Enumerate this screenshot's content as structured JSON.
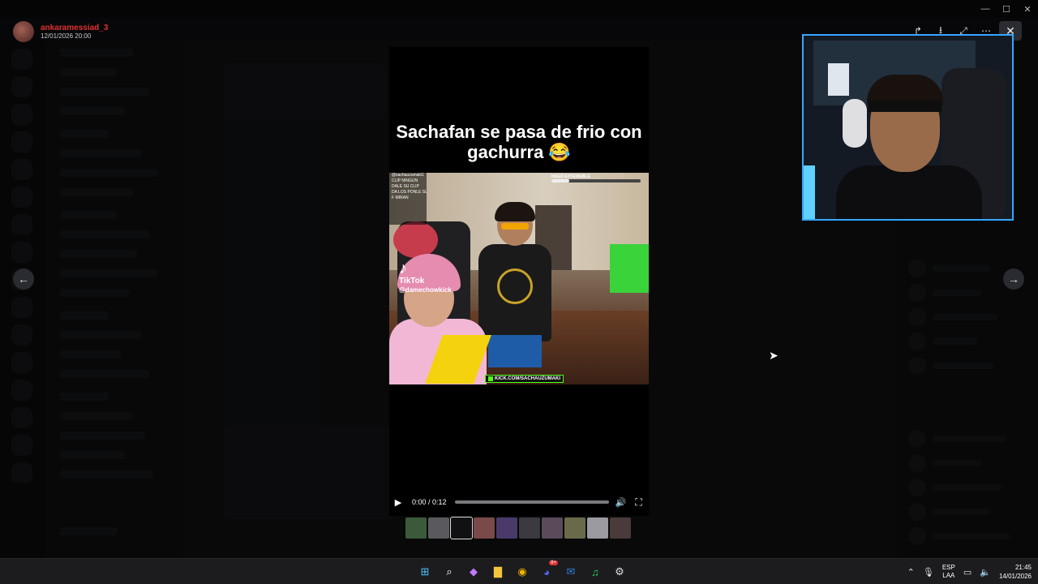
{
  "uploader": {
    "name": "ankaramessiad_3",
    "date": "12/01/2026 20:00"
  },
  "window": {
    "title": "",
    "minimize": "—",
    "maximize": "☐",
    "close": "✕"
  },
  "viewer_toolbar": {
    "share": "↱",
    "download": "⭳",
    "open": "⤢",
    "more": "⋯",
    "close": "✕"
  },
  "nav": {
    "prev": "←",
    "next": "→"
  },
  "video": {
    "caption": "Sachafan se pasa de frio con gachurra 😂",
    "overlay_lines": [
      "@sachauzumaki1",
      "CLIP NINGUN",
      "DALE SU CLIP",
      "DA LOS PONLE SU",
      "F MIRAN"
    ],
    "hago_label": "HAGO EXTENSIBLE",
    "hago_progress": 0.2,
    "tiktok_label": "TikTok",
    "tiktok_handle": "@damechowkick",
    "kick_label": "KICK.COM/SACHAUZUMAKI",
    "time_current": "0:00",
    "time_total": "0:12",
    "time_display": "0:00 / 0:12",
    "progress": 0.0
  },
  "thumbnails": [
    {
      "color": "#3a5a3a"
    },
    {
      "color": "#5a5a5e"
    },
    {
      "color": "#111114"
    },
    {
      "color": "#7a4a4a"
    },
    {
      "color": "#4a3a6a"
    },
    {
      "color": "#3a3a40"
    },
    {
      "color": "#5a4a5a"
    },
    {
      "color": "#6a6a4a"
    },
    {
      "color": "#9a9aa0"
    },
    {
      "color": "#4a3a3a"
    }
  ],
  "taskbar": {
    "apps": [
      {
        "name": "start",
        "glyph": "⊞",
        "color": "#4cc2ff"
      },
      {
        "name": "search",
        "glyph": "⌕",
        "color": "#ffffff"
      },
      {
        "name": "copilot",
        "glyph": "◆",
        "color": "#c07bff"
      },
      {
        "name": "explorer",
        "glyph": "▇",
        "color": "#f4c43b"
      },
      {
        "name": "chrome",
        "glyph": "◉",
        "color": "#f0b400"
      },
      {
        "name": "discord",
        "glyph": "◕",
        "color": "#5865f2",
        "badge": "9+"
      },
      {
        "name": "outlook",
        "glyph": "✉",
        "color": "#2a7fd9"
      },
      {
        "name": "spotify",
        "glyph": "♫",
        "color": "#1ed760"
      },
      {
        "name": "steam",
        "glyph": "⚙",
        "color": "#dddddd"
      }
    ],
    "lang_top": "ESP",
    "lang_bottom": "LAA",
    "time": "21:45",
    "date": "14/01/2026"
  }
}
